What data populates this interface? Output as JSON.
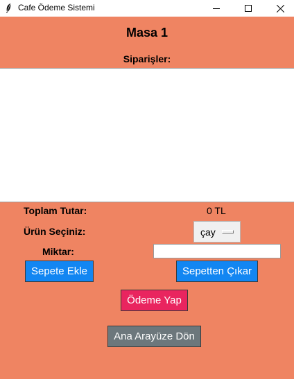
{
  "window": {
    "title": "Cafe Ödeme Sistemi",
    "icon": "feather-icon"
  },
  "header": {
    "table_title": "Masa 1",
    "orders_label": "Siparişler:"
  },
  "orders": {
    "items": []
  },
  "summary": {
    "total_label": "Toplam Tutar:",
    "total_value": "0 TL",
    "product_label": "Ürün Seçiniz:",
    "product_selected": "çay",
    "quantity_label": "Miktar:",
    "quantity_value": ""
  },
  "buttons": {
    "add_to_cart": "Sepete Ekle",
    "remove_from_cart": "Sepetten Çıkar",
    "pay": "Ödeme Yap",
    "back_to_main": "Ana Arayüze Dön"
  },
  "colors": {
    "background": "#ef8462",
    "blue_button": "#1286f2",
    "pay_button": "#e9255f",
    "back_button": "#6c777c"
  }
}
